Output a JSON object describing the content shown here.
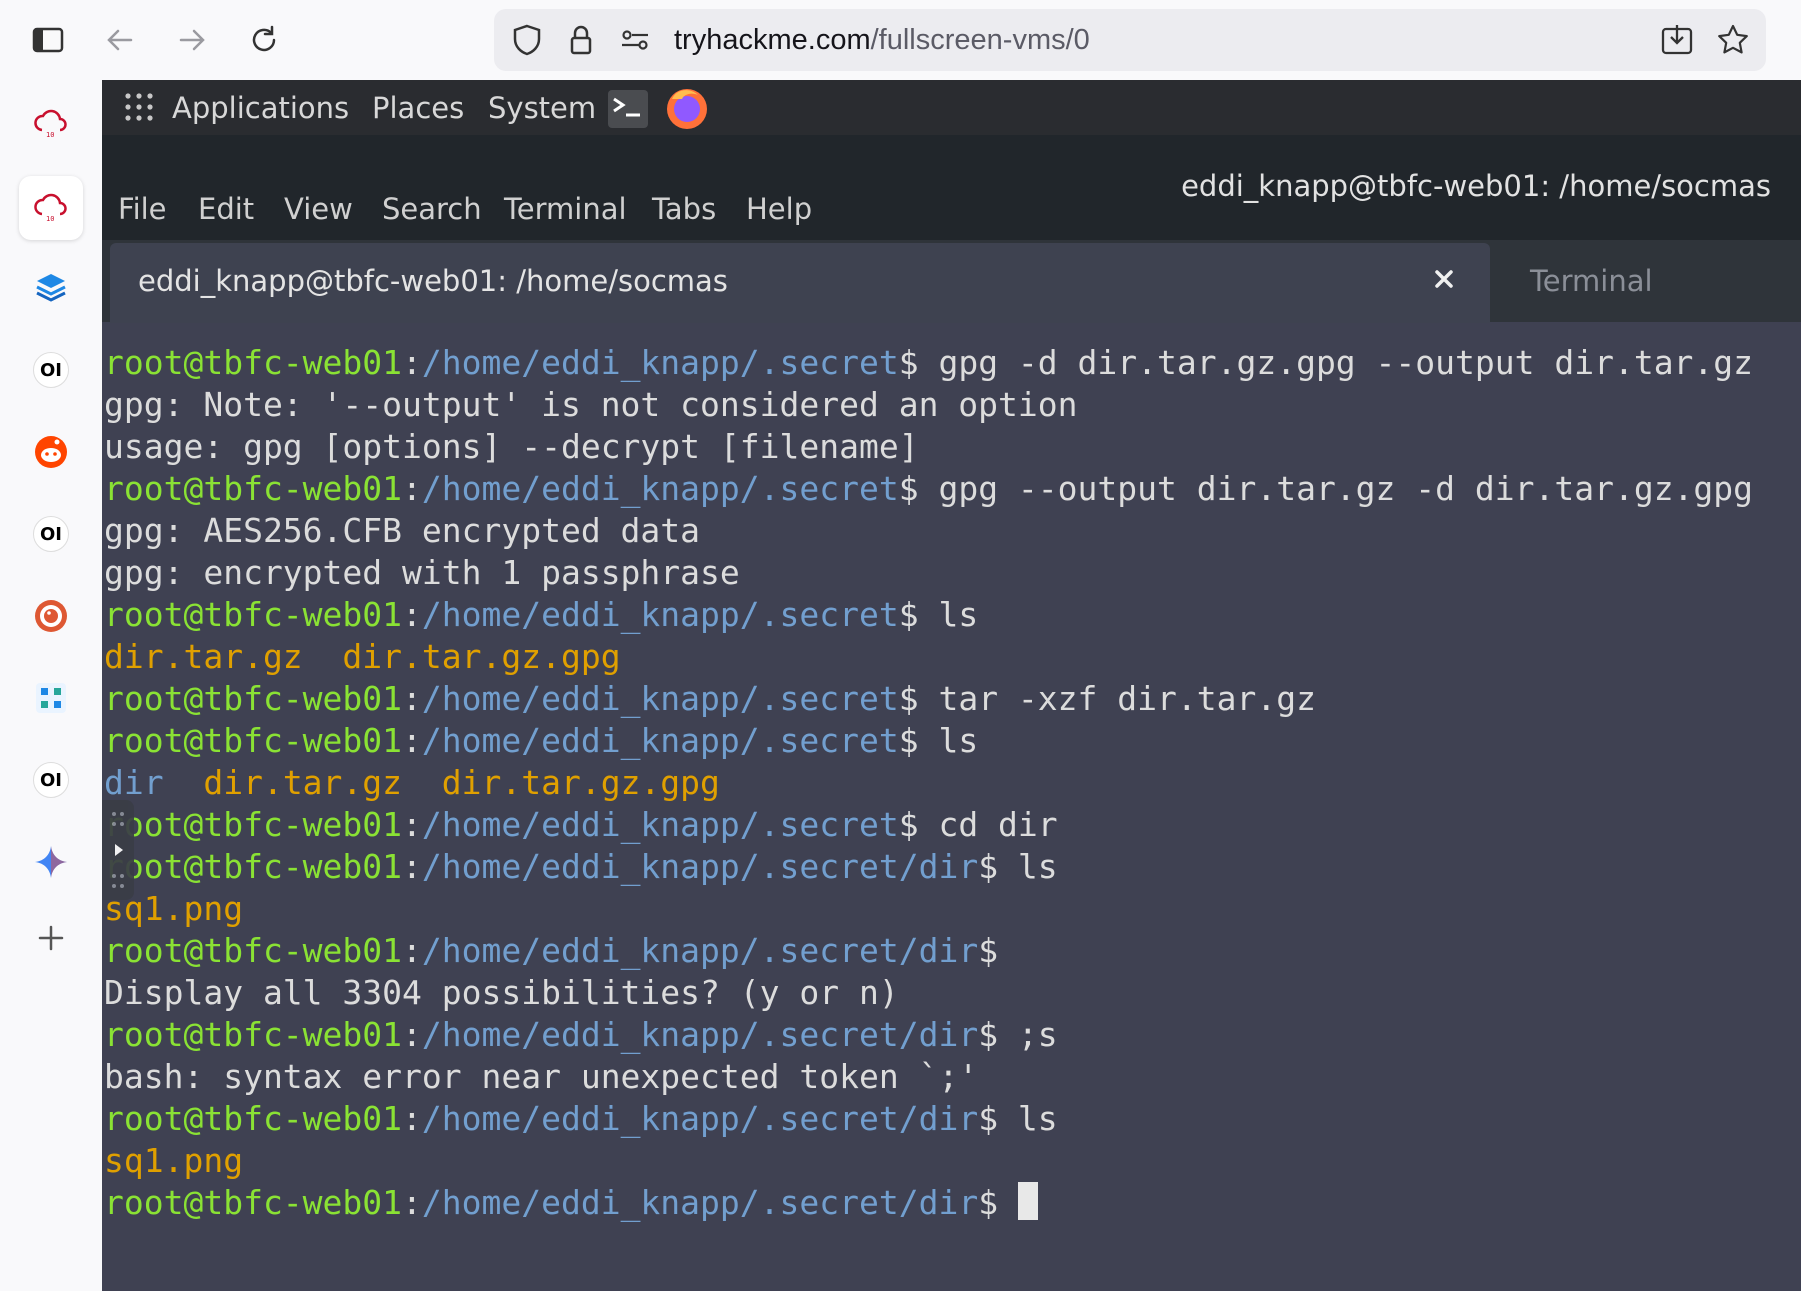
{
  "browser": {
    "url_domain": "tryhackme.com",
    "url_path": "/fullscreen-vms/0"
  },
  "sidebar": {
    "items": [
      {
        "name": "tryhackme-cloud-icon"
      },
      {
        "name": "tryhackme-cloud-icon-active"
      },
      {
        "name": "stack-icon"
      },
      {
        "name": "ol-icon",
        "text": "OI"
      },
      {
        "name": "reddit-icon"
      },
      {
        "name": "ol-icon",
        "text": "OI"
      },
      {
        "name": "duckduckgo-icon"
      },
      {
        "name": "grid-icon"
      },
      {
        "name": "ol-icon",
        "text": "OI"
      },
      {
        "name": "gemini-icon"
      },
      {
        "name": "add-icon"
      }
    ]
  },
  "vm": {
    "panel": {
      "applications": "Applications",
      "places": "Places",
      "system": "System"
    },
    "window_title": "eddi_knapp@tbfc-web01: /home/socmas",
    "menu": [
      "File",
      "Edit",
      "View",
      "Search",
      "Terminal",
      "Tabs",
      "Help"
    ],
    "tabs": {
      "active": "eddi_knapp@tbfc-web01: /home/socmas",
      "inactive": "Terminal"
    },
    "terminal": {
      "user": "root@tbfc-web01",
      "colon": ":",
      "lines": [
        {
          "path": "/home/eddi_knapp/.secret",
          "cmd": "$ gpg -d dir.tar.gz.gpg --output dir.tar.gz"
        },
        {
          "out": "gpg: Note: '--output' is not considered an option"
        },
        {
          "out": "usage: gpg [options] --decrypt [filename]"
        },
        {
          "path": "/home/eddi_knapp/.secret",
          "cmd": "$ gpg --output dir.tar.gz -d dir.tar.gz.gpg"
        },
        {
          "out": "gpg: AES256.CFB encrypted data"
        },
        {
          "out": "gpg: encrypted with 1 passphrase"
        },
        {
          "path": "/home/eddi_knapp/.secret",
          "cmd": "$ ls"
        },
        {
          "files": "dir.tar.gz  dir.tar.gz.gpg"
        },
        {
          "path": "/home/eddi_knapp/.secret",
          "cmd": "$ tar -xzf dir.tar.gz"
        },
        {
          "path": "/home/eddi_knapp/.secret",
          "cmd": "$ ls"
        },
        {
          "dir": "dir",
          "files": "  dir.tar.gz  dir.tar.gz.gpg"
        },
        {
          "path": "/home/eddi_knapp/.secret",
          "cmd": "$ cd dir"
        },
        {
          "path": "/home/eddi_knapp/.secret/dir",
          "cmd": "$ ls"
        },
        {
          "files": "sq1.png"
        },
        {
          "path": "/home/eddi_knapp/.secret/dir",
          "cmd": "$"
        },
        {
          "out": "Display all 3304 possibilities? (y or n)"
        },
        {
          "path": "/home/eddi_knapp/.secret/dir",
          "cmd": "$ ;s"
        },
        {
          "out": "bash: syntax error near unexpected token `;'"
        },
        {
          "path": "/home/eddi_knapp/.secret/dir",
          "cmd": "$ ls"
        },
        {
          "files": "sq1.png"
        },
        {
          "path": "/home/eddi_knapp/.secret/dir",
          "cmd": "$ "
        }
      ]
    }
  },
  "colors": {
    "prompt_user": "#8ae234",
    "prompt_path": "#729fcf",
    "archive_file": "#e0a000",
    "directory": "#729fcf",
    "terminal_bg": "#3f4152"
  }
}
